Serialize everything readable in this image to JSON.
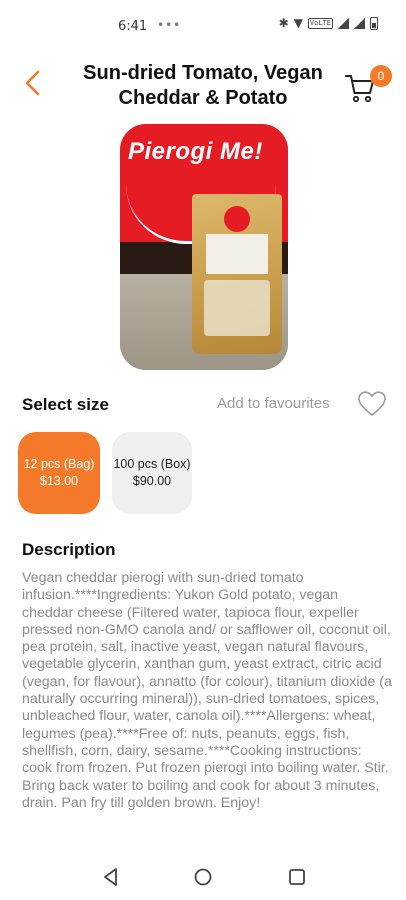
{
  "status_bar": {
    "time": "6:41",
    "extra": "•••"
  },
  "header": {
    "back_icon": "chevron-left-icon",
    "title": "Sun-dried Tomato, Vegan Cheddar & Potato",
    "cart_icon": "cart-icon",
    "cart_count": "0"
  },
  "product": {
    "image_sign_text": "Pierogi Me!"
  },
  "size_section": {
    "label": "Select size",
    "favourites_label": "Add to favourites",
    "options": [
      {
        "name": "12 pcs (Bag)",
        "price": "$13.00",
        "selected": true
      },
      {
        "name": "100 pcs (Box)",
        "price": "$90.00",
        "selected": false
      }
    ]
  },
  "description": {
    "title": "Description",
    "text": "Vegan cheddar pierogi with sun-dried tomato infusion.****Ingredients: Yukon Gold potato, vegan cheddar cheese (Filtered water, tapioca flour, expeller pressed non-GMO canola and/ or safflower oil, coconut oil, pea protein, salt, inactive yeast, vegan natural flavours, vegetable glycerin, xanthan gum, yeast extract, citric acid (vegan, for flavour), annatto (for colour), titanium dioxide (a naturally occurring mineral)), sun-dried tomatoes, spices, unbleached flour, water, canola oil).****Allergens: wheat, legumes (pea).****Free of: nuts, peanuts, eggs, fish, shellfish, corn, dairy, sesame.****Cooking instructions: cook from frozen. Put frozen pierogi into boiling water. Stir. Bring back water to boiling and cook for about 3 minutes, drain. Pan fry till golden brown. Enjoy!"
  },
  "colors": {
    "accent": "#f47a2a",
    "unselected_option": "#efefef",
    "muted_text": "#8a8a8a"
  }
}
